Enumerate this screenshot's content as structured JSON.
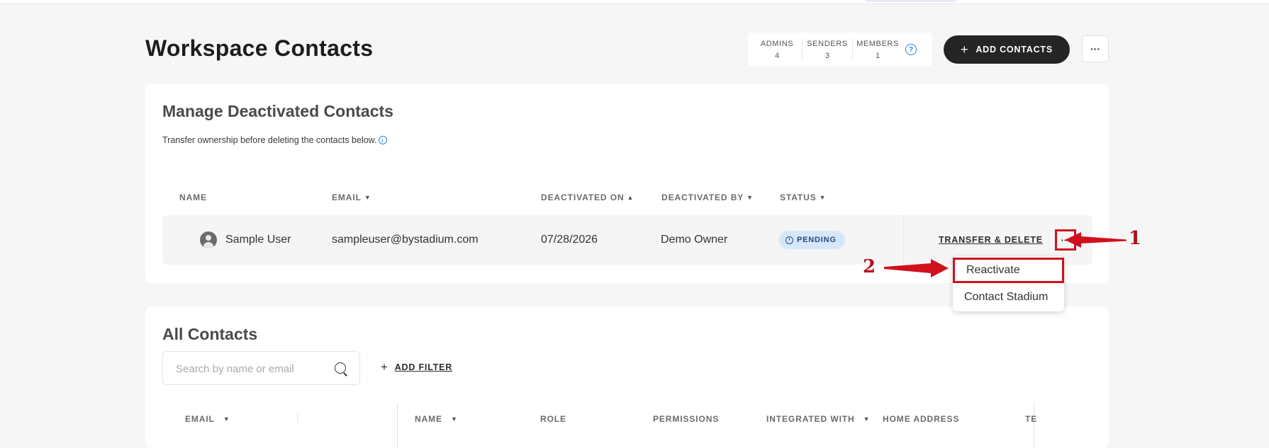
{
  "page": {
    "title": "Workspace Contacts"
  },
  "stats": [
    {
      "label": "ADMINS",
      "value": "4"
    },
    {
      "label": "SENDERS",
      "value": "3"
    },
    {
      "label": "MEMBERS",
      "value": "1"
    }
  ],
  "header": {
    "help_icon": "?",
    "add_contacts_label": "ADD CONTACTS",
    "more_label": "···"
  },
  "deactivated": {
    "title": "Manage Deactivated Contacts",
    "subtitle": "Transfer ownership before deleting the contacts below.",
    "info_icon": "i",
    "columns": {
      "name": "NAME",
      "email": "EMAIL",
      "deactivated_on": "DEACTIVATED ON",
      "deactivated_by": "DEACTIVATED BY",
      "status": "STATUS"
    },
    "row": {
      "name": "Sample User",
      "email": "sampleuser@bystadium.com",
      "deactivated_on": "07/28/2026",
      "deactivated_by": "Demo Owner",
      "status": "PENDING",
      "action": "TRANSFER & DELETE",
      "more": "···"
    },
    "menu": [
      "Reactivate",
      "Contact Stadium"
    ]
  },
  "all_contacts": {
    "title": "All Contacts",
    "search_placeholder": "Search by name or email",
    "add_filter": "ADD FILTER",
    "columns": {
      "email": "EMAIL",
      "name": "NAME",
      "role": "ROLE",
      "permissions": "PERMISSIONS",
      "integrated_with": "INTEGRATED WITH",
      "home_address": "HOME ADDRESS",
      "truncated": "TE"
    }
  },
  "annotations": {
    "step1": "1",
    "step2": "2",
    "color": "#d0101c"
  }
}
